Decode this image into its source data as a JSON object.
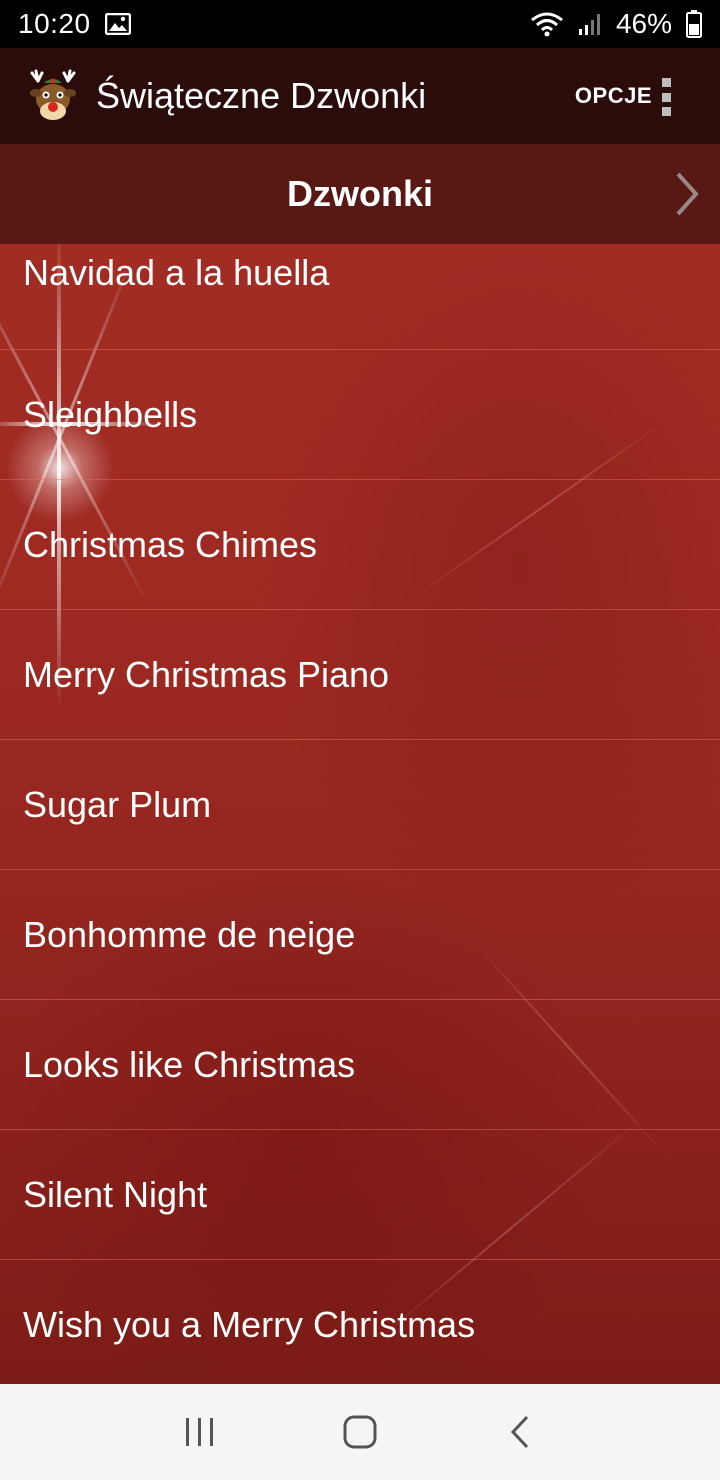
{
  "status_bar": {
    "time": "10:20",
    "battery_percent": "46%",
    "icons": [
      "image-icon",
      "wifi-icon",
      "signal-icon",
      "battery-icon"
    ]
  },
  "app_bar": {
    "title": "Świąteczne Dzwonki",
    "options_label": "OPCJE",
    "logo_icon": "reindeer-icon",
    "menu_icon": "overflow-menu-icon"
  },
  "section": {
    "title": "Dzwonki",
    "next_icon": "chevron-right-icon"
  },
  "ringtones": [
    "Navidad a la huella",
    "Sleighbells",
    "Christmas Chimes",
    "Merry Christmas Piano",
    "Sugar Plum",
    "Bonhomme de neige",
    "Looks like Christmas",
    "Silent Night",
    "Wish you a Merry Christmas"
  ],
  "nav_bar": {
    "icons": [
      "recent-apps-icon",
      "home-icon",
      "back-icon"
    ]
  },
  "colors": {
    "app_bar": "#2a0d0b",
    "background": "#9e2a22",
    "nav_bar": "#f5f5f5"
  }
}
